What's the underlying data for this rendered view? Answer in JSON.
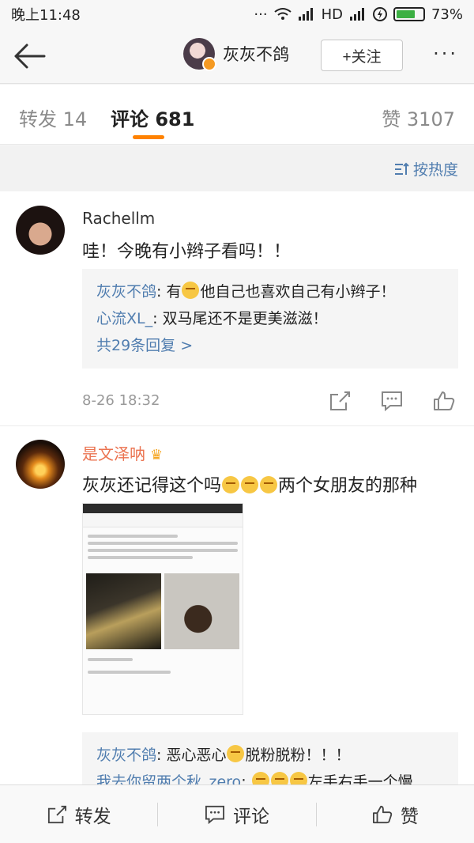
{
  "status_bar": {
    "time": "晚上11:48",
    "dots": "···",
    "network": "HD",
    "battery": "73%"
  },
  "nav": {
    "user_name": "灰灰不鸽",
    "follow_label": "+关注",
    "more": "···"
  },
  "tabs": [
    {
      "label": "转发 14"
    },
    {
      "label": "评论 681"
    },
    {
      "label": "赞 3107"
    }
  ],
  "sort": {
    "label": "按热度"
  },
  "comments": [
    {
      "user": "Rachellm",
      "text": "哇！今晚有小辫子看吗！！",
      "replies": [
        {
          "user": "灰灰不鸽",
          "sep": ": ",
          "pre": "有",
          "post": "他自己也喜欢自己有小辫子！"
        },
        {
          "user": "心流XL_",
          "sep": ": ",
          "text": "双马尾还不是更美滋滋！"
        }
      ],
      "reply_count": "共29条回复 >",
      "time": "8-26 18:32"
    },
    {
      "user": "是文泽呐",
      "text_pre": "灰灰还记得这个吗",
      "text_post": "两个女朋友的那种",
      "replies": [
        {
          "user": "灰灰不鸽",
          "sep": ": ",
          "pre": "恶心恶心",
          "post": "脱粉脱粉！！！"
        },
        {
          "user": "我去你留两个秋_zero",
          "sep": ": ",
          "text": "左手右手一个慢"
        }
      ]
    }
  ],
  "bottom_bar": {
    "repost": "转发",
    "comment": "评论",
    "like": "赞"
  },
  "colors": {
    "accent": "#ff8200",
    "link": "#507daf",
    "vip": "#eb7350"
  }
}
